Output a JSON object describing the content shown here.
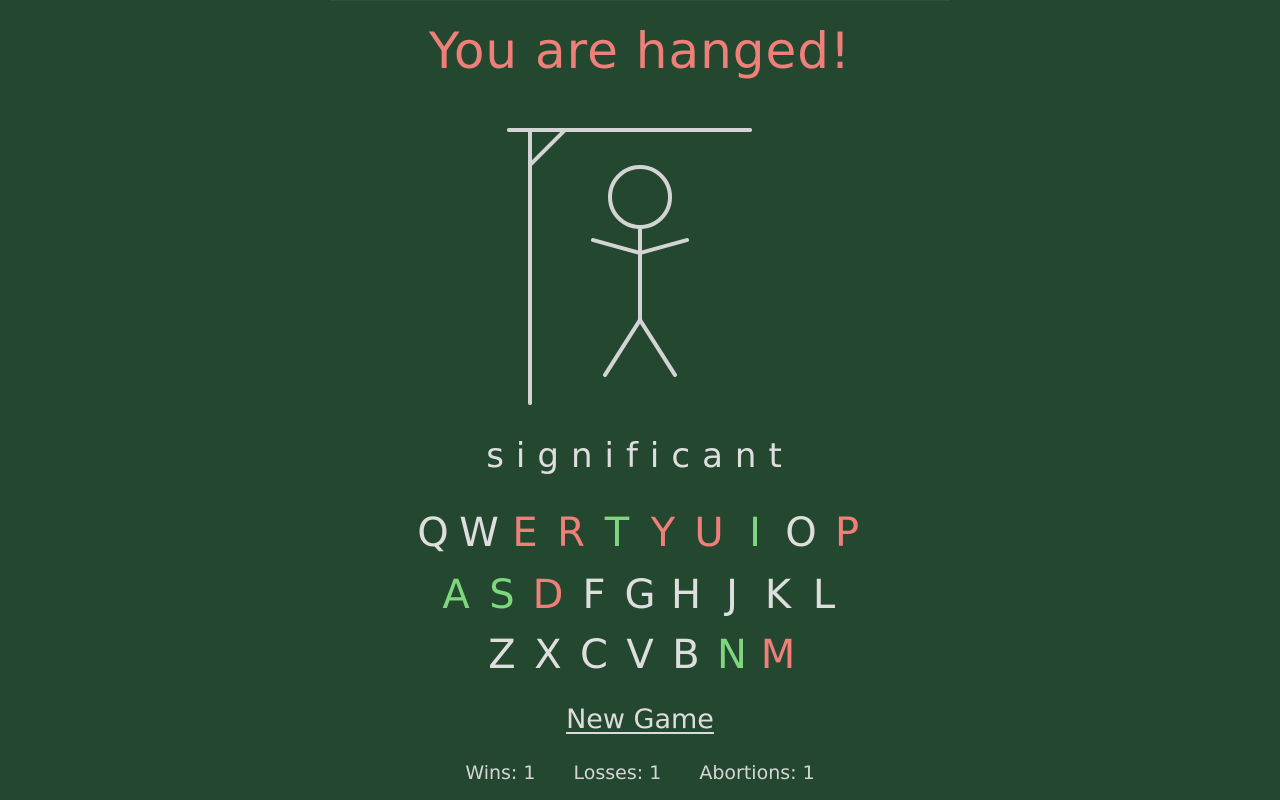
{
  "status": {
    "message": "You are hanged!",
    "color": "#f07f7a"
  },
  "word": "significant",
  "colors": {
    "unused": "#dedede",
    "correct": "#7ed67e",
    "wrong": "#f07f7a"
  },
  "keyboard": {
    "rows": [
      [
        {
          "key": "Q",
          "state": "unused"
        },
        {
          "key": "W",
          "state": "unused"
        },
        {
          "key": "E",
          "state": "wrong"
        },
        {
          "key": "R",
          "state": "wrong"
        },
        {
          "key": "T",
          "state": "correct"
        },
        {
          "key": "Y",
          "state": "wrong"
        },
        {
          "key": "U",
          "state": "wrong"
        },
        {
          "key": "I",
          "state": "correct"
        },
        {
          "key": "O",
          "state": "unused"
        },
        {
          "key": "P",
          "state": "wrong"
        }
      ],
      [
        {
          "key": "A",
          "state": "correct"
        },
        {
          "key": "S",
          "state": "correct"
        },
        {
          "key": "D",
          "state": "wrong"
        },
        {
          "key": "F",
          "state": "unused"
        },
        {
          "key": "G",
          "state": "unused"
        },
        {
          "key": "H",
          "state": "unused"
        },
        {
          "key": "J",
          "state": "unused"
        },
        {
          "key": "K",
          "state": "unused"
        },
        {
          "key": "L",
          "state": "unused"
        }
      ],
      [
        {
          "key": "Z",
          "state": "unused"
        },
        {
          "key": "X",
          "state": "unused"
        },
        {
          "key": "C",
          "state": "unused"
        },
        {
          "key": "V",
          "state": "unused"
        },
        {
          "key": "B",
          "state": "unused"
        },
        {
          "key": "N",
          "state": "correct"
        },
        {
          "key": "M",
          "state": "wrong"
        }
      ]
    ]
  },
  "new_game_label": "New Game",
  "stats": {
    "wins": "Wins: 1",
    "losses": "Losses: 1",
    "abortions": "Abortions: 1"
  },
  "hangman": {
    "stage": "complete",
    "parts_drawn": [
      "gallows",
      "head",
      "body",
      "left-arm",
      "right-arm",
      "left-leg",
      "right-leg"
    ]
  }
}
